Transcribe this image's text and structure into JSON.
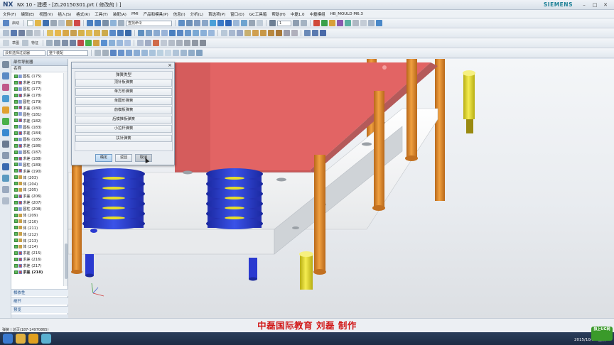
{
  "window": {
    "logo": "NX",
    "title": "NX 10 - 建模 - [ZL20150301.prt  ( 修改的 ) ]",
    "brand": "SIEMENS",
    "controls": [
      "–",
      "□",
      "✕"
    ]
  },
  "menu": [
    "文件(F)",
    "编辑(E)",
    "视图(V)",
    "插入(S)",
    "格式(R)",
    "工具(T)",
    "装配(A)",
    "PMI",
    "产品和模具(P)",
    "信息(I)",
    "分析(L)",
    "首选项(P)",
    "窗口(O)",
    "GC工具箱",
    "帮助(H)",
    "中磊1.0",
    "中磊模组",
    "HB_MOULD M6.3"
  ],
  "toolbar": {
    "start_label": "启动",
    "command_search": "查找命令",
    "layer_value": "1",
    "selection_filter": "没有选择过滤器",
    "assembly_scope": "整个装配",
    "sketch_label": "草图",
    "feature_label": "特征"
  },
  "navigator": {
    "title": "部件导航器",
    "column_header": "名称",
    "items": [
      {
        "icon": "col",
        "label": "圆柱 (175)"
      },
      {
        "icon": "unite",
        "label": "求差 (176)"
      },
      {
        "icon": "col",
        "label": "圆柱 (177)"
      },
      {
        "icon": "unite",
        "label": "求差 (178)"
      },
      {
        "icon": "col",
        "label": "圆柱 (179)"
      },
      {
        "icon": "unite",
        "label": "求差 (180)"
      },
      {
        "icon": "col",
        "label": "圆柱 (181)"
      },
      {
        "icon": "unite",
        "label": "求差 (182)"
      },
      {
        "icon": "col",
        "label": "圆柱 (183)"
      },
      {
        "icon": "unite",
        "label": "求差 (184)"
      },
      {
        "icon": "col",
        "label": "圆柱 (185)"
      },
      {
        "icon": "unite",
        "label": "求差 (186)"
      },
      {
        "icon": "col",
        "label": "圆柱 (187)"
      },
      {
        "icon": "unite",
        "label": "求差 (188)"
      },
      {
        "icon": "col",
        "label": "圆柱 (189)"
      },
      {
        "icon": "unite",
        "label": "求差 (190)"
      },
      {
        "icon": "body",
        "label": "体 (203)"
      },
      {
        "icon": "body",
        "label": "体 (204)"
      },
      {
        "icon": "body",
        "label": "体 (205)"
      },
      {
        "icon": "unite",
        "label": "求差 (206)"
      },
      {
        "icon": "unite",
        "label": "求差 (207)"
      },
      {
        "icon": "col",
        "label": "圆柱 (208)"
      },
      {
        "icon": "body",
        "label": "体 (209)"
      },
      {
        "icon": "body",
        "label": "体 (210)"
      },
      {
        "icon": "body",
        "label": "体 (211)"
      },
      {
        "icon": "body",
        "label": "体 (212)"
      },
      {
        "icon": "body",
        "label": "体 (213)"
      },
      {
        "icon": "body",
        "label": "体 (214)"
      },
      {
        "icon": "unite",
        "label": "求差 (215)"
      },
      {
        "icon": "unite",
        "label": "求差 (216)"
      },
      {
        "icon": "unite",
        "label": "求差 (217)"
      },
      {
        "icon": "unite",
        "label": "求差 (218)"
      }
    ],
    "sections": [
      "相依性",
      "细节",
      "预览"
    ]
  },
  "dialog": {
    "group_label": "弹簧类型",
    "options": [
      "顶针板弹簧",
      "单方形弹簧",
      "单圆形弹簧",
      "前模板弹簧",
      "后模推板弹簧",
      "小拉杆弹簧",
      "扶针弹簧"
    ],
    "ok": "确定",
    "back": "返回",
    "cancel": "取消"
  },
  "status": {
    "text": "弹簧 | 总页(187-14970865)",
    "caption": "中磊国际教育   刘磊   制作"
  },
  "taskbar": {
    "clock": "2015/10/12 星期一",
    "corner_logo": "狼上UG网"
  },
  "colors": {
    "mold_plate": "#e26464",
    "mold_plate_side": "#b45a5a",
    "base_plate": "#f4f4f4",
    "spring": "#2b3fd1",
    "pin_orange": "#e8962a",
    "pin_yellow": "#e8df2a",
    "caption_red": "#d11a1a"
  }
}
